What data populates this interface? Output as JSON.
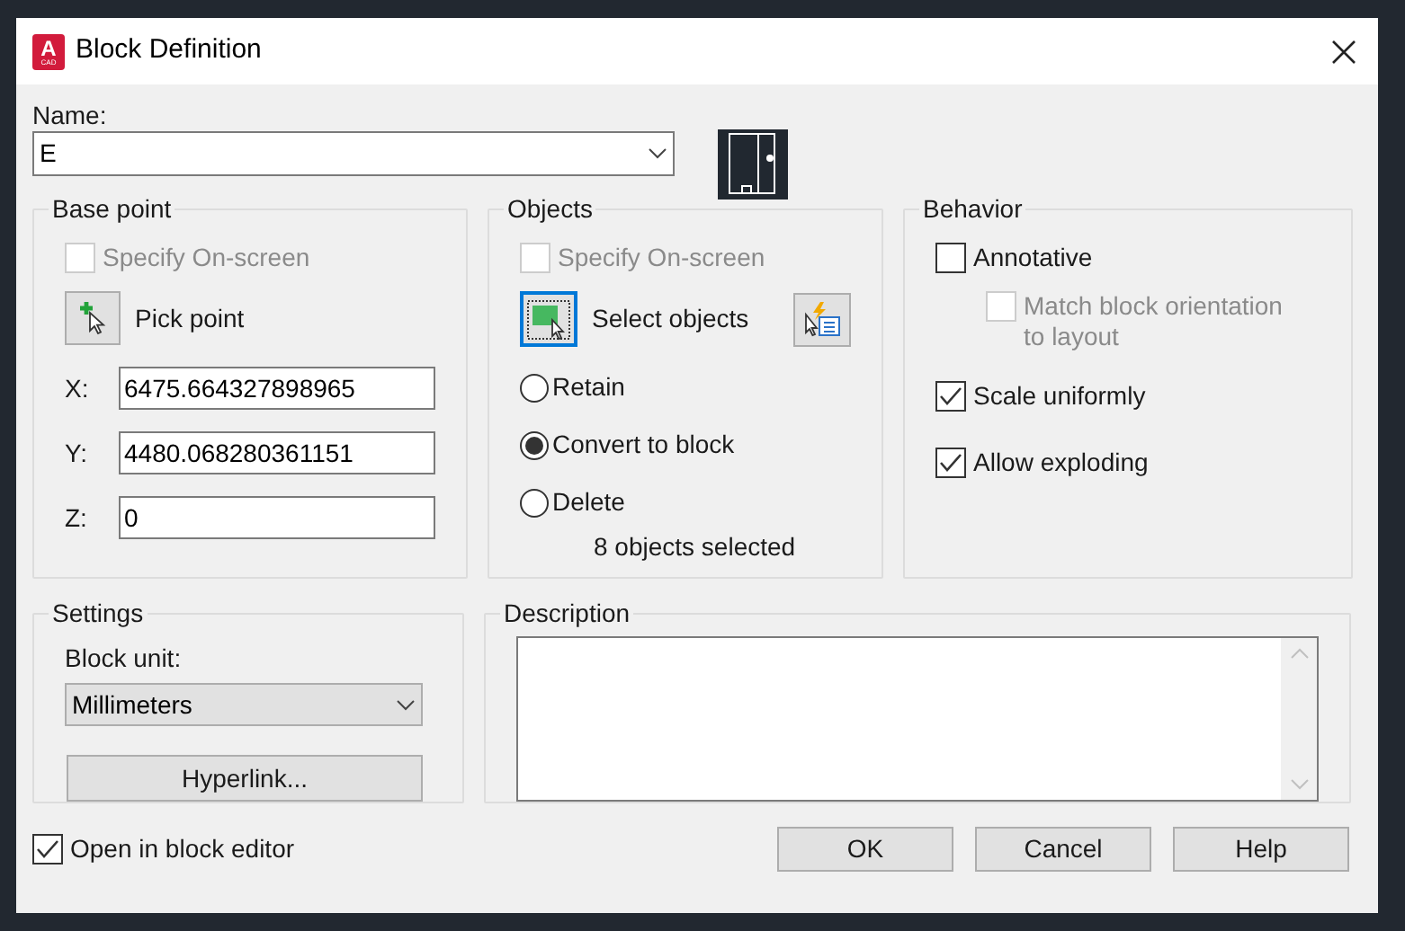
{
  "window": {
    "title": "Block Definition",
    "app_icon_letter": "A",
    "app_icon_caption": "CAD"
  },
  "name_field": {
    "label": "Name:",
    "value": "E"
  },
  "base_point": {
    "title": "Base point",
    "specify_on_screen": {
      "label": "Specify On-screen",
      "checked": false,
      "disabled": true
    },
    "pick_button": "Pick point",
    "coords": [
      {
        "label": "X:",
        "value": "6475.664327898965"
      },
      {
        "label": "Y:",
        "value": "4480.068280361151"
      },
      {
        "label": "Z:",
        "value": "0"
      }
    ]
  },
  "objects": {
    "title": "Objects",
    "specify_on_screen": {
      "label": "Specify On-screen",
      "checked": false,
      "disabled": true
    },
    "select_button": "Select objects",
    "options": [
      {
        "label": "Retain",
        "selected": false
      },
      {
        "label": "Convert to block",
        "selected": true
      },
      {
        "label": "Delete",
        "selected": false
      }
    ],
    "status": "8 objects selected"
  },
  "behavior": {
    "title": "Behavior",
    "options": [
      {
        "label": "Annotative",
        "checked": false,
        "disabled": false,
        "indented": false
      },
      {
        "label": "Match block orientation to layout",
        "checked": false,
        "disabled": true,
        "indented": true
      },
      {
        "label": "Scale uniformly",
        "checked": true,
        "disabled": false,
        "indented": false
      },
      {
        "label": "Allow exploding",
        "checked": true,
        "disabled": false,
        "indented": false
      }
    ]
  },
  "settings": {
    "title": "Settings",
    "unit_label": "Block unit:",
    "unit_value": "Millimeters",
    "hyperlink_button": "Hyperlink..."
  },
  "description": {
    "title": "Description"
  },
  "open_in_editor": {
    "label": "Open in block editor",
    "checked": true
  },
  "buttons": [
    "OK",
    "Cancel",
    "Help"
  ]
}
